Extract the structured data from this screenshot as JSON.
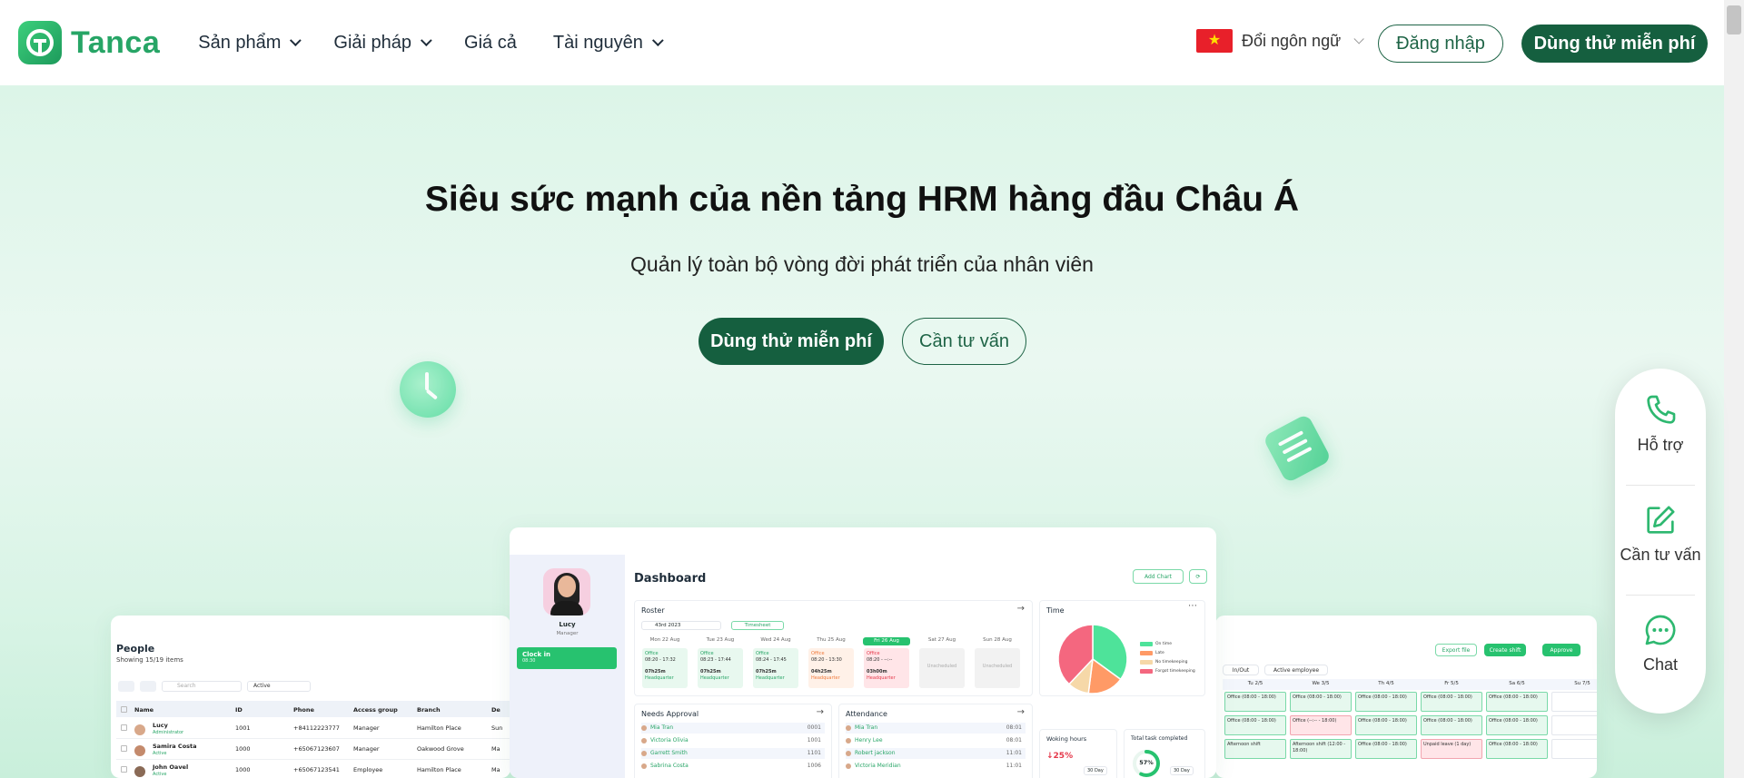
{
  "brand": {
    "name": "Tanca"
  },
  "nav": {
    "items": [
      {
        "label": "Sản phẩm",
        "dropdown": true
      },
      {
        "label": "Giải pháp",
        "dropdown": true
      },
      {
        "label": "Giá cả",
        "dropdown": false
      },
      {
        "label": "Tài nguyên",
        "dropdown": true
      }
    ]
  },
  "header": {
    "language_label": "Đổi ngôn ngữ",
    "login_label": "Đăng nhập",
    "trial_label": "Dùng thử miễn phí"
  },
  "hero": {
    "title": "Siêu sức mạnh của nền tảng HRM hàng đầu Châu Á",
    "subtitle": "Quản lý toàn bộ vòng đời phát triển của nhân viên",
    "primary_cta": "Dùng thử miễn phí",
    "secondary_cta": "Cần tư vấn"
  },
  "people_panel": {
    "title": "People",
    "subtitle": "Showing 15/19 items",
    "search_placeholder": "Search",
    "filter_value": "Active",
    "columns": [
      "Name",
      "ID",
      "Phone",
      "Access group",
      "Branch",
      "De"
    ],
    "rows": [
      {
        "name": "Lucy",
        "tag": "Administrator",
        "id": "1001",
        "phone": "+84112223777",
        "group": "Manager",
        "branch": "Hamilton Place",
        "dept": "Sun"
      },
      {
        "name": "Samira Costa",
        "tag": "Active",
        "id": "1000",
        "phone": "+65067123607",
        "group": "Manager",
        "branch": "Oakwood Grove",
        "dept": "Ma"
      },
      {
        "name": "John Oavel",
        "tag": "Active",
        "id": "1000",
        "phone": "+65067123541",
        "group": "Employee",
        "branch": "Hamilton Place",
        "dept": "Ma"
      }
    ]
  },
  "dashboard_panel": {
    "user_name": "Lucy",
    "user_role": "Manager",
    "clock_in_label": "Clock in",
    "clock_in_time": "08:30",
    "title": "Dashboard",
    "add_chart_label": "Add Chart",
    "roster": {
      "title": "Roster",
      "date_value": "43rd 2023",
      "timesheet_label": "Timesheet",
      "days": [
        "Mon 22 Aug",
        "Tue 23 Aug",
        "Wed 24 Aug",
        "Thu 25 Aug",
        "Fri 26 Aug",
        "Sat 27 Aug",
        "Sun 28 Aug"
      ],
      "shifts": [
        {
          "title": "Office",
          "time": "08:20 - 17:32",
          "hours": "07h25m",
          "place": "Headquarter",
          "status": "ok"
        },
        {
          "title": "Office",
          "time": "08:23 - 17:44",
          "hours": "07h25m",
          "place": "Headquarter",
          "status": "ok"
        },
        {
          "title": "Office",
          "time": "08:24 - 17:45",
          "hours": "07h25m",
          "place": "Headquarter",
          "status": "ok"
        },
        {
          "title": "Office",
          "time": "08:20 - 13:30",
          "hours": "04h25m",
          "place": "Headquarter",
          "status": "warn"
        },
        {
          "title": "Office",
          "time": "08:20 - --:--",
          "hours": "03h00m",
          "place": "Headquarter",
          "status": "late"
        },
        {
          "title": "Unscheduled",
          "time": "",
          "hours": "",
          "place": "",
          "status": "off"
        },
        {
          "title": "Unscheduled",
          "time": "",
          "hours": "",
          "place": "",
          "status": "off"
        }
      ]
    },
    "time_card": {
      "title": "Time",
      "legend": [
        "On time",
        "Late",
        "No timekeeping",
        "Forgot timekeeping"
      ],
      "slices": [
        {
          "label": "On time",
          "value": 35,
          "color": "#4ee39a"
        },
        {
          "label": "Late",
          "value": 17,
          "color": "#ff9a66"
        },
        {
          "label": "No timekeeping",
          "value": 10,
          "color": "#f6d8a8"
        },
        {
          "label": "Forgot timekeeping",
          "value": 38,
          "color": "#f4677f"
        }
      ]
    },
    "needs_approval": {
      "title": "Needs Approval",
      "rows": [
        {
          "name": "Mia Tran",
          "num": "0001"
        },
        {
          "name": "Victoria Olivia",
          "num": "1001"
        },
        {
          "name": "Garrett Smith",
          "num": "1101"
        },
        {
          "name": "Sabrina Costa",
          "num": "1006"
        }
      ]
    },
    "attendance": {
      "title": "Attendance",
      "rows": [
        {
          "name": "Mia Tran",
          "num": "08:01"
        },
        {
          "name": "Henry Lee",
          "num": "08:01"
        },
        {
          "name": "Robert jackson",
          "num": "11:01"
        },
        {
          "name": "Victoria Meridian",
          "num": "11:01"
        }
      ]
    },
    "working_hours": {
      "title": "Woking hours",
      "change": "↓25%",
      "period": "30 Day"
    },
    "task_completed": {
      "title": "Total task completed",
      "percent": "57%",
      "progress": 0.57,
      "period": "30 Day"
    }
  },
  "schedule_panel": {
    "export_label": "Export file",
    "create_shift_label": "Create shift",
    "approve_label": "Approve",
    "filter_1": "In/Out",
    "filter_2": "Active employee",
    "columns": [
      "Tu 2/5",
      "We 3/5",
      "Th 4/5",
      "Fr 5/5",
      "Sa 6/5",
      "Su 7/5"
    ],
    "rows": [
      [
        "Office (08:00 - 18:00)",
        "Office (08:00 - 18:00)",
        "Office (08:00 - 18:00)",
        "Office (08:00 - 18:00)",
        "Office (08:00 - 18:00)",
        ""
      ],
      [
        "Office (08:00 - 18:00)",
        "Office (--:-- - 18:00)",
        "Office (08:00 - 18:00)",
        "Office (08:00 - 18:00)",
        "Office (08:00 - 18:00)",
        ""
      ],
      [
        "Afternoon shift",
        "Afternoon shift (12:00 - 18:00)",
        "Office (08:00 - 18:00)",
        "Unpaid leave (1 day)",
        "Office (08:00 - 18:00)",
        ""
      ]
    ]
  },
  "support_widget": {
    "items": [
      {
        "label": "Hỗ trợ",
        "icon": "phone-icon"
      },
      {
        "label": "Cần tư vấn",
        "icon": "edit-icon"
      },
      {
        "label": "Chat",
        "icon": "chat-icon"
      }
    ]
  }
}
